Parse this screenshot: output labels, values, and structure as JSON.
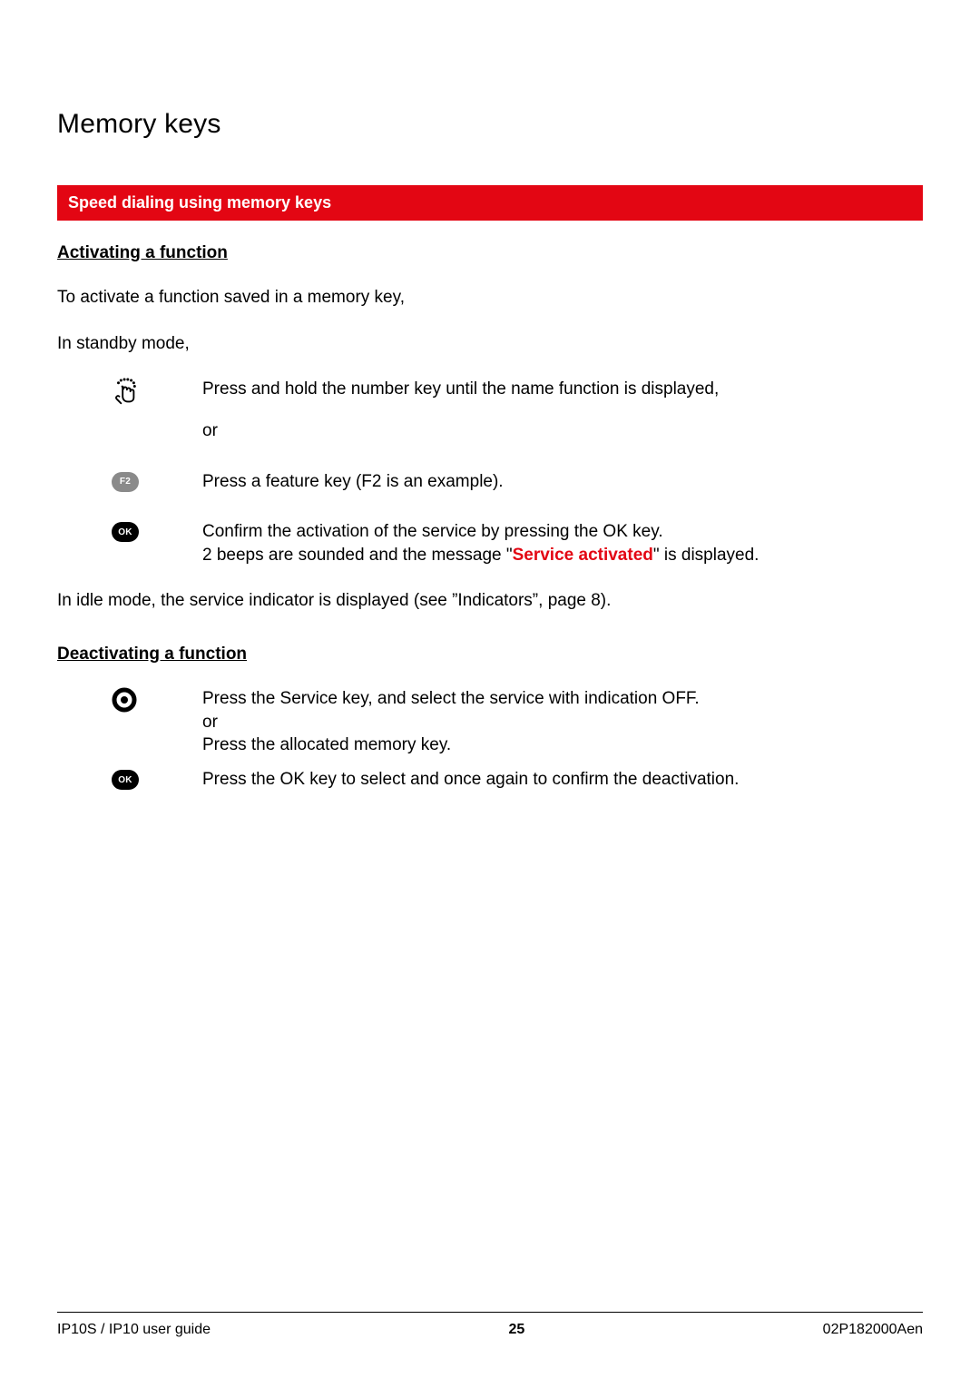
{
  "heading": "Memory keys",
  "section_bar": "Speed dialing using memory keys",
  "activating": {
    "title": "Activating a function",
    "intro1": "To activate a function saved in a memory key,",
    "intro2": "In standby mode,",
    "step1": "Press and hold the number key until the name function is displayed,",
    "step1_or": "or",
    "f2_label": "F2",
    "step2": "Press a feature key (F2 is an example).",
    "ok_label": "OK",
    "step3a": "Confirm the activation of the service by pressing the OK key.",
    "step3b_pre": "2 beeps are sounded and the message \"",
    "step3b_msg": "Service activated",
    "step3b_post": "\" is displayed.",
    "idle_line": "In idle mode, the service indicator is displayed (see ”Indicators”, page 8)."
  },
  "deactivating": {
    "title": "Deactivating a function",
    "step1a": "Press the Service key, and select the service with indication OFF.",
    "step1b": "or",
    "step1c": "Press the allocated memory key.",
    "ok_label": "OK",
    "step2": "Press the OK key to select and once again to confirm the deactivation."
  },
  "footer": {
    "left": "IP10S / IP10 user guide",
    "center": "25",
    "right": "02P182000Aen"
  }
}
